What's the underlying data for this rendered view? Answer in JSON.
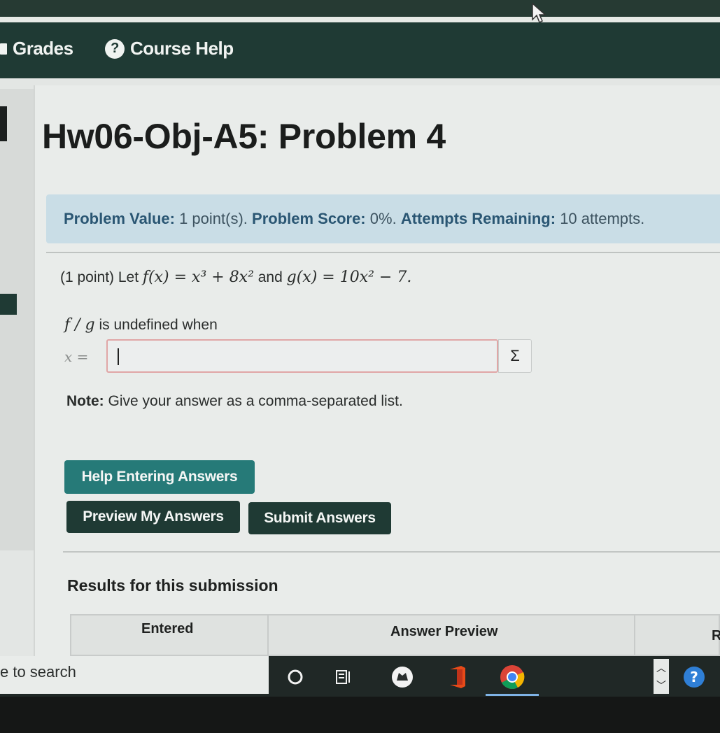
{
  "nav": {
    "grades_label": "Grades",
    "help_label": "Course Help",
    "help_icon_glyph": "?"
  },
  "problem_title": "Hw06-Obj-A5: Problem 4",
  "info": {
    "value_label": "Problem Value:",
    "value_text": "1 point(s).",
    "score_label": "Problem Score:",
    "score_text": "0%.",
    "attempts_label": "Attempts Remaining:",
    "attempts_text": "10 attempts."
  },
  "problem": {
    "intro": "(1 point) Let ",
    "f_expr": "f(x) = x³ + 8x²",
    "and_text": " and ",
    "g_expr": "g(x) = 10x² − 7.",
    "prompt_math": "f / g",
    "prompt_text": " is undefined when",
    "var_label": "x =",
    "answer_value": "",
    "sigma_glyph": "Σ",
    "note_label": "Note:",
    "note_text": " Give your answer as a comma-separated list."
  },
  "buttons": {
    "help_entering": "Help Entering Answers",
    "preview": "Preview My Answers",
    "submit": "Submit Answers"
  },
  "results": {
    "heading": "Results for this submission",
    "col_entered": "Entered",
    "col_preview": "Answer Preview",
    "col_r": "R"
  },
  "taskbar": {
    "search_text": "e to search"
  },
  "colors": {
    "nav_bg": "#1f3a34",
    "info_bg": "#c9dde6",
    "help_button": "#267a78",
    "dark_button": "#1f3a34"
  }
}
